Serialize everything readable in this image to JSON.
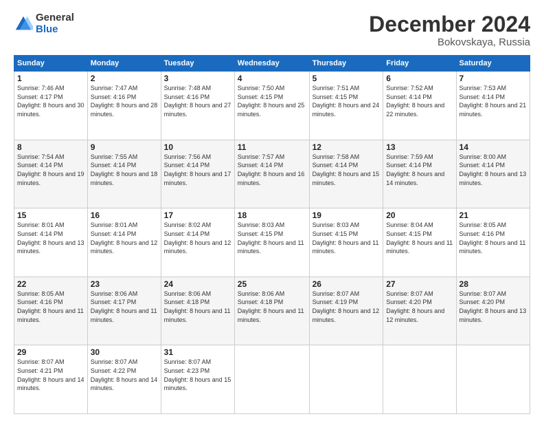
{
  "logo": {
    "general": "General",
    "blue": "Blue"
  },
  "title": "December 2024",
  "location": "Bokovskaya, Russia",
  "days_of_week": [
    "Sunday",
    "Monday",
    "Tuesday",
    "Wednesday",
    "Thursday",
    "Friday",
    "Saturday"
  ],
  "weeks": [
    [
      {
        "day": "1",
        "sunrise": "7:46 AM",
        "sunset": "4:17 PM",
        "daylight": "8 hours and 30 minutes."
      },
      {
        "day": "2",
        "sunrise": "7:47 AM",
        "sunset": "4:16 PM",
        "daylight": "8 hours and 28 minutes."
      },
      {
        "day": "3",
        "sunrise": "7:48 AM",
        "sunset": "4:16 PM",
        "daylight": "8 hours and 27 minutes."
      },
      {
        "day": "4",
        "sunrise": "7:50 AM",
        "sunset": "4:15 PM",
        "daylight": "8 hours and 25 minutes."
      },
      {
        "day": "5",
        "sunrise": "7:51 AM",
        "sunset": "4:15 PM",
        "daylight": "8 hours and 24 minutes."
      },
      {
        "day": "6",
        "sunrise": "7:52 AM",
        "sunset": "4:14 PM",
        "daylight": "8 hours and 22 minutes."
      },
      {
        "day": "7",
        "sunrise": "7:53 AM",
        "sunset": "4:14 PM",
        "daylight": "8 hours and 21 minutes."
      }
    ],
    [
      {
        "day": "8",
        "sunrise": "7:54 AM",
        "sunset": "4:14 PM",
        "daylight": "8 hours and 19 minutes."
      },
      {
        "day": "9",
        "sunrise": "7:55 AM",
        "sunset": "4:14 PM",
        "daylight": "8 hours and 18 minutes."
      },
      {
        "day": "10",
        "sunrise": "7:56 AM",
        "sunset": "4:14 PM",
        "daylight": "8 hours and 17 minutes."
      },
      {
        "day": "11",
        "sunrise": "7:57 AM",
        "sunset": "4:14 PM",
        "daylight": "8 hours and 16 minutes."
      },
      {
        "day": "12",
        "sunrise": "7:58 AM",
        "sunset": "4:14 PM",
        "daylight": "8 hours and 15 minutes."
      },
      {
        "day": "13",
        "sunrise": "7:59 AM",
        "sunset": "4:14 PM",
        "daylight": "8 hours and 14 minutes."
      },
      {
        "day": "14",
        "sunrise": "8:00 AM",
        "sunset": "4:14 PM",
        "daylight": "8 hours and 13 minutes."
      }
    ],
    [
      {
        "day": "15",
        "sunrise": "8:01 AM",
        "sunset": "4:14 PM",
        "daylight": "8 hours and 13 minutes."
      },
      {
        "day": "16",
        "sunrise": "8:01 AM",
        "sunset": "4:14 PM",
        "daylight": "8 hours and 12 minutes."
      },
      {
        "day": "17",
        "sunrise": "8:02 AM",
        "sunset": "4:14 PM",
        "daylight": "8 hours and 12 minutes."
      },
      {
        "day": "18",
        "sunrise": "8:03 AM",
        "sunset": "4:15 PM",
        "daylight": "8 hours and 11 minutes."
      },
      {
        "day": "19",
        "sunrise": "8:03 AM",
        "sunset": "4:15 PM",
        "daylight": "8 hours and 11 minutes."
      },
      {
        "day": "20",
        "sunrise": "8:04 AM",
        "sunset": "4:15 PM",
        "daylight": "8 hours and 11 minutes."
      },
      {
        "day": "21",
        "sunrise": "8:05 AM",
        "sunset": "4:16 PM",
        "daylight": "8 hours and 11 minutes."
      }
    ],
    [
      {
        "day": "22",
        "sunrise": "8:05 AM",
        "sunset": "4:16 PM",
        "daylight": "8 hours and 11 minutes."
      },
      {
        "day": "23",
        "sunrise": "8:06 AM",
        "sunset": "4:17 PM",
        "daylight": "8 hours and 11 minutes."
      },
      {
        "day": "24",
        "sunrise": "8:06 AM",
        "sunset": "4:18 PM",
        "daylight": "8 hours and 11 minutes."
      },
      {
        "day": "25",
        "sunrise": "8:06 AM",
        "sunset": "4:18 PM",
        "daylight": "8 hours and 11 minutes."
      },
      {
        "day": "26",
        "sunrise": "8:07 AM",
        "sunset": "4:19 PM",
        "daylight": "8 hours and 12 minutes."
      },
      {
        "day": "27",
        "sunrise": "8:07 AM",
        "sunset": "4:20 PM",
        "daylight": "8 hours and 12 minutes."
      },
      {
        "day": "28",
        "sunrise": "8:07 AM",
        "sunset": "4:20 PM",
        "daylight": "8 hours and 13 minutes."
      }
    ],
    [
      {
        "day": "29",
        "sunrise": "8:07 AM",
        "sunset": "4:21 PM",
        "daylight": "8 hours and 14 minutes."
      },
      {
        "day": "30",
        "sunrise": "8:07 AM",
        "sunset": "4:22 PM",
        "daylight": "8 hours and 14 minutes."
      },
      {
        "day": "31",
        "sunrise": "8:07 AM",
        "sunset": "4:23 PM",
        "daylight": "8 hours and 15 minutes."
      },
      null,
      null,
      null,
      null
    ]
  ]
}
